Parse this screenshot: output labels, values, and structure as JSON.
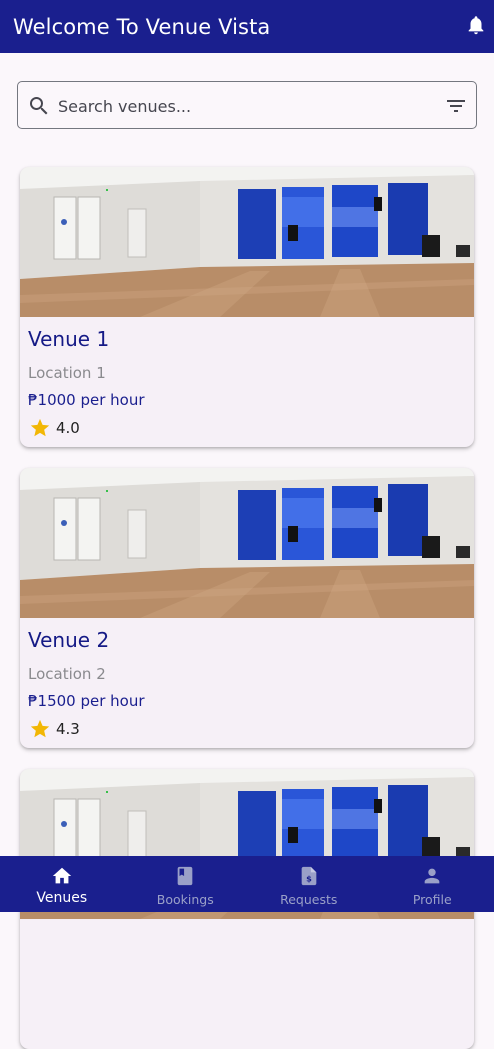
{
  "appbar": {
    "title": "Welcome To Venue Vista",
    "notification_icon": "bell-icon"
  },
  "search": {
    "placeholder": "Search venues...",
    "value": "",
    "search_icon": "search-icon",
    "filter_icon": "filter-icon"
  },
  "venues": [
    {
      "name": "Venue 1",
      "location": "Location 1",
      "price": "₱1000 per hour",
      "rating": "4.0"
    },
    {
      "name": "Venue 2",
      "location": "Location 2",
      "price": "₱1500 per hour",
      "rating": "4.3"
    },
    {
      "name": "",
      "location": "",
      "price": "",
      "rating": ""
    }
  ],
  "bottom_nav": {
    "items": [
      {
        "label": "Venues",
        "icon": "home-icon",
        "active": true
      },
      {
        "label": "Bookings",
        "icon": "book-icon",
        "active": false
      },
      {
        "label": "Requests",
        "icon": "document-dollar-icon",
        "active": false
      },
      {
        "label": "Profile",
        "icon": "person-icon",
        "active": false
      }
    ]
  },
  "colors": {
    "primary": "#1a1f8e",
    "background": "#fbf7fb",
    "card": "#f6f0f7",
    "star": "#f2b705",
    "nav_inactive": "#9aa0c8"
  }
}
